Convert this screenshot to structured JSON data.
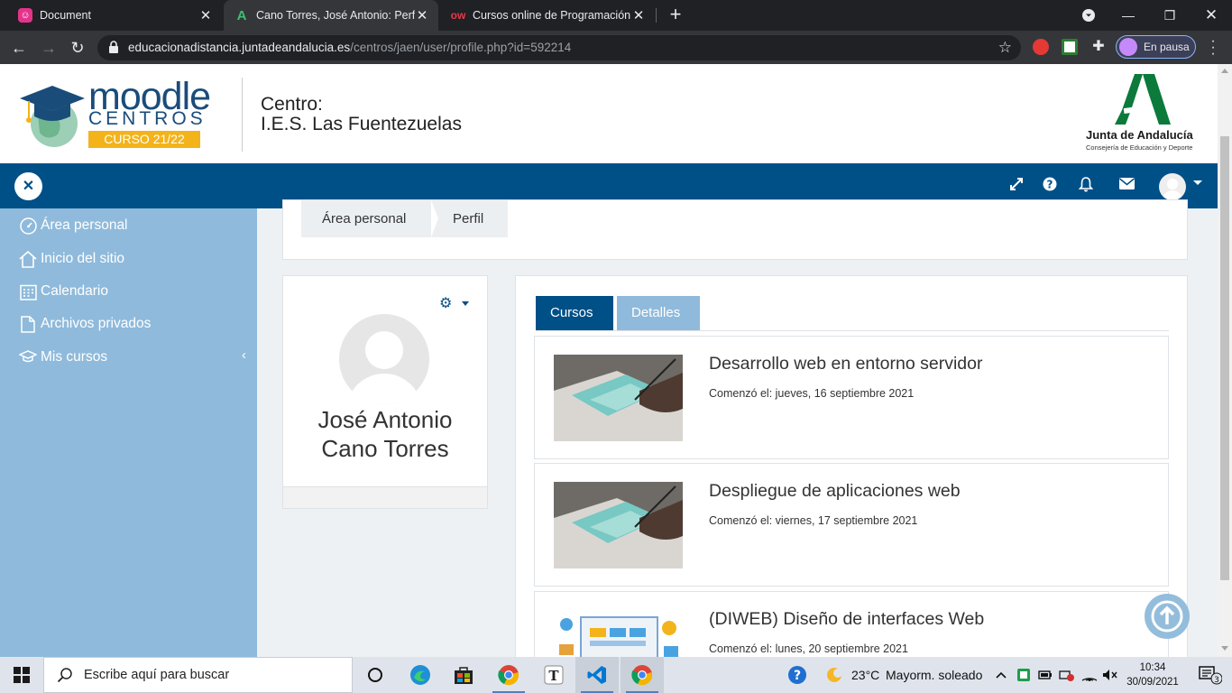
{
  "browser": {
    "tabs": [
      {
        "title": "Document"
      },
      {
        "title": "Cano Torres, José Antonio: Perfil p"
      },
      {
        "title": "Cursos online de Programación y"
      }
    ],
    "url_host": "educacionadistancia.juntadeandalucia.es",
    "url_path": "/centros/jaen/user/profile.php?id=592214",
    "profile_label": "En pausa"
  },
  "header": {
    "logo_moodle": "moodle",
    "logo_centros": "CENTROS",
    "logo_curso": "CURSO 21/22",
    "centro_label": "Centro:",
    "centro_name": "I.E.S. Las Fuentezuelas",
    "junta_name": "Junta de Andalucía",
    "junta_sub": "Consejería de Educación y Deporte"
  },
  "drawer": {
    "items": [
      {
        "label": "Área personal",
        "icon": "dashboard-icon"
      },
      {
        "label": "Inicio del sitio",
        "icon": "home-icon"
      },
      {
        "label": "Calendario",
        "icon": "calendar-icon"
      },
      {
        "label": "Archivos privados",
        "icon": "file-icon"
      },
      {
        "label": "Mis cursos",
        "icon": "graduation-cap-icon"
      }
    ]
  },
  "breadcrumb": [
    "Área personal",
    "Perfil"
  ],
  "profile": {
    "first_name": "José Antonio",
    "last_name": "Cano Torres"
  },
  "tabs": [
    "Cursos",
    "Detalles"
  ],
  "courses": [
    {
      "name": "Desarrollo web en entorno servidor",
      "started": "Comenzó el: jueves, 16 septiembre 2021"
    },
    {
      "name": "Despliegue de aplicaciones web",
      "started": "Comenzó el: viernes, 17 septiembre 2021"
    },
    {
      "name": "(DIWEB) Diseño de interfaces Web",
      "started": "Comenzó el: lunes, 20 septiembre 2021"
    }
  ],
  "taskbar": {
    "search_placeholder": "Escribe aquí para buscar",
    "weather_temp": "23°C",
    "weather_text": "Mayorm. soleado",
    "time": "10:34",
    "date": "30/09/2021",
    "notifications": "3"
  },
  "colors": {
    "brand_blue": "#005088",
    "drawer_blue": "#8fbadb",
    "moodle_yellow": "#f3b31a",
    "junta_green": "#0b7a3a"
  }
}
